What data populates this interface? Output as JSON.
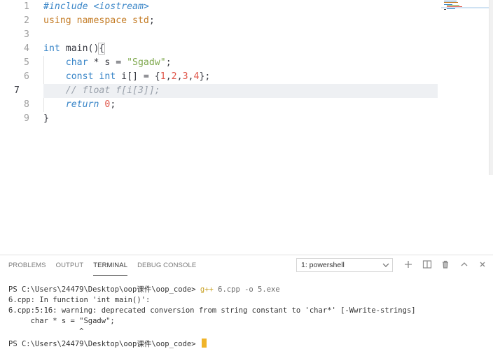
{
  "editor": {
    "line_numbers": [
      "1",
      "2",
      "3",
      "4",
      "5",
      "6",
      "7",
      "8",
      "9"
    ],
    "lines": [
      [
        {
          "t": "#include <iostream>",
          "c": "pp"
        }
      ],
      [
        {
          "t": "using namespace std",
          "c": "kw"
        },
        {
          "t": ";",
          "c": ""
        }
      ],
      [],
      [
        {
          "t": "int",
          "c": "ty"
        },
        {
          "t": " main()",
          "c": ""
        },
        {
          "t": "{",
          "c": "brace"
        }
      ],
      [
        {
          "t": "    ",
          "c": ""
        },
        {
          "t": "char",
          "c": "ty"
        },
        {
          "t": " * s = ",
          "c": ""
        },
        {
          "t": "\"Sgadw\"",
          "c": "str"
        },
        {
          "t": ";",
          "c": ""
        }
      ],
      [
        {
          "t": "    ",
          "c": ""
        },
        {
          "t": "const int",
          "c": "ty"
        },
        {
          "t": " i[] = {",
          "c": ""
        },
        {
          "t": "1",
          "c": "nm"
        },
        {
          "t": ",",
          "c": ""
        },
        {
          "t": "2",
          "c": "nm"
        },
        {
          "t": ",",
          "c": ""
        },
        {
          "t": "3",
          "c": "nm"
        },
        {
          "t": ",",
          "c": ""
        },
        {
          "t": "4",
          "c": "nm"
        },
        {
          "t": "};",
          "c": ""
        }
      ],
      [
        {
          "t": "    ",
          "c": ""
        },
        {
          "t": "// float f[i[3]];",
          "c": "cm"
        }
      ],
      [
        {
          "t": "    ",
          "c": ""
        },
        {
          "t": "return",
          "c": "kw2i"
        },
        {
          "t": " ",
          "c": ""
        },
        {
          "t": "0",
          "c": "nm"
        },
        {
          "t": ";",
          "c": ""
        }
      ],
      [
        {
          "t": "}",
          "c": "brace"
        }
      ]
    ],
    "current_line": 7
  },
  "panel": {
    "tabs": [
      "PROBLEMS",
      "OUTPUT",
      "TERMINAL",
      "DEBUG CONSOLE"
    ],
    "active_tab": "TERMINAL",
    "terminal_select": "1: powershell",
    "tool_icons": [
      "add-icon",
      "split-icon",
      "trash-icon",
      "chevron-up-icon",
      "close-icon"
    ]
  },
  "terminal": {
    "prompt1": "PS C:\\Users\\24479\\Desktop\\oop课件\\oop_code> ",
    "cmd": "g++",
    "args": " 6.cpp -o 5.exe",
    "out1": "6.cpp: In function 'int main()':",
    "out2": "6.cpp:5:16: warning: deprecated conversion from string constant to 'char*' [-Wwrite-strings]",
    "out3": "     char * s = \"Sgadw\";",
    "out4": "                ^",
    "prompt2": "PS C:\\Users\\24479\\Desktop\\oop课件\\oop_code> "
  },
  "colors": {
    "accent": "#f0b429",
    "keyword": "#c47c26",
    "type": "#3a86c8",
    "string": "#7ea84d",
    "number": "#e0564a"
  }
}
